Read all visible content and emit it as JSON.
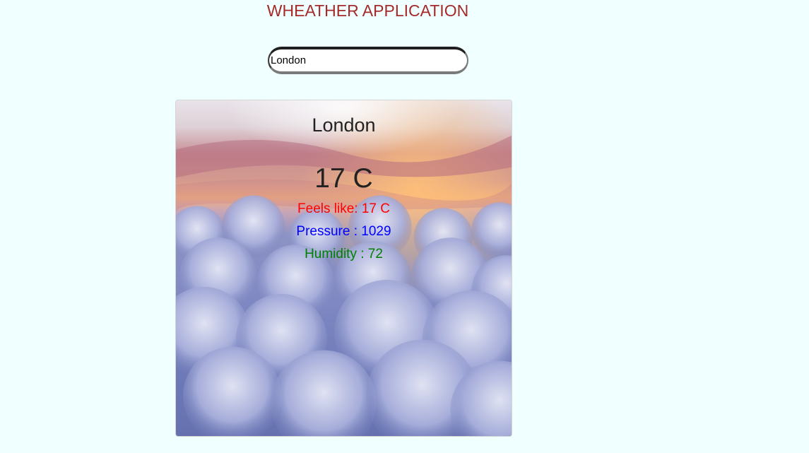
{
  "app": {
    "title": "WHEATHER APPLICATION"
  },
  "search": {
    "value": "London"
  },
  "weather": {
    "city": "London",
    "temperature": "17 C",
    "feels_like": "Feels like: 17 C",
    "pressure": "Pressure : 1029",
    "humidity": "Humidity : 72"
  },
  "colors": {
    "background": "#f0ffff",
    "title": "#a52a2a",
    "feels_like": "#ff0000",
    "pressure": "#0000ff",
    "humidity": "#008000"
  }
}
